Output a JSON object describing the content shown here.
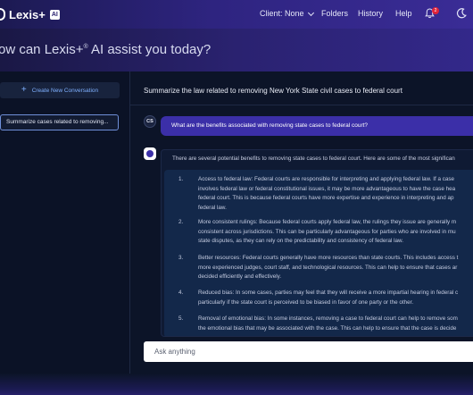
{
  "header": {
    "brand": "Lexis+",
    "brand_badge": "AI",
    "nav": {
      "client": "Client: None",
      "folders": "Folders",
      "history": "History",
      "help": "Help"
    },
    "notification_count": "2",
    "icons": [
      "bell-icon",
      "moon-icon",
      "chevron-down-icon"
    ]
  },
  "hero": {
    "title": "ow can Lexis+",
    "title_sup": "®",
    "title_rest": " AI assist you today?"
  },
  "sidebar": {
    "new_conversation": "Create New Conversation",
    "conversations": [
      "Summarize cases related to removing..."
    ]
  },
  "main": {
    "title": "Summarize the law related to removing New York State civil cases to federal court",
    "user_initials": "CS",
    "user_question": "What are the benefits associated with removing state cases to federal court?",
    "answer_intro": "There are several potential benefits to removing state cases to federal court. Here are some of the most significan",
    "points": [
      {
        "num": "1.",
        "lines": [
          "Access to federal law: Federal courts are responsible for interpreting and applying federal law. If a case",
          "involves federal law or federal constitutional issues, it may be more advantageous to have the case hea",
          "federal court. This is because federal courts have more expertise and experience in interpreting and ap",
          "federal law."
        ]
      },
      {
        "num": "2.",
        "lines": [
          "More consistent rulings: Because federal courts apply federal law, the rulings they issue are generally m",
          "consistent across jurisdictions. This can be particularly advantageous for parties who are involved in mu",
          "state disputes, as they can rely on the predictability and consistency of federal law."
        ]
      },
      {
        "num": "3.",
        "lines": [
          "Better resources: Federal courts generally have more resources than state courts. This includes access t",
          "more experienced judges, court staff, and technological resources. This can help to ensure that cases ar",
          "decided efficiently and effectively."
        ]
      },
      {
        "num": "4.",
        "lines": [
          "Reduced bias: In some cases, parties may feel that they will receive a more impartial hearing in federal c",
          "particularly if the state court is perceived to be biased in favor of one party or the other."
        ]
      },
      {
        "num": "5.",
        "lines": [
          "Removal of emotional bias: In some instances, removing a case to federal court can help to remove som",
          "the emotional bias that may be associated with the case. This can help to ensure that the case is decide"
        ]
      }
    ],
    "input_placeholder": "Ask anything"
  },
  "colors": {
    "header_gradient_start": "#1c1a52",
    "header_gradient_end": "#3a2c96",
    "page_bg": "#0c1428",
    "user_bubble": "#3b2fa8",
    "link_blue": "#7fb0ff",
    "badge_red": "#e0243a"
  }
}
